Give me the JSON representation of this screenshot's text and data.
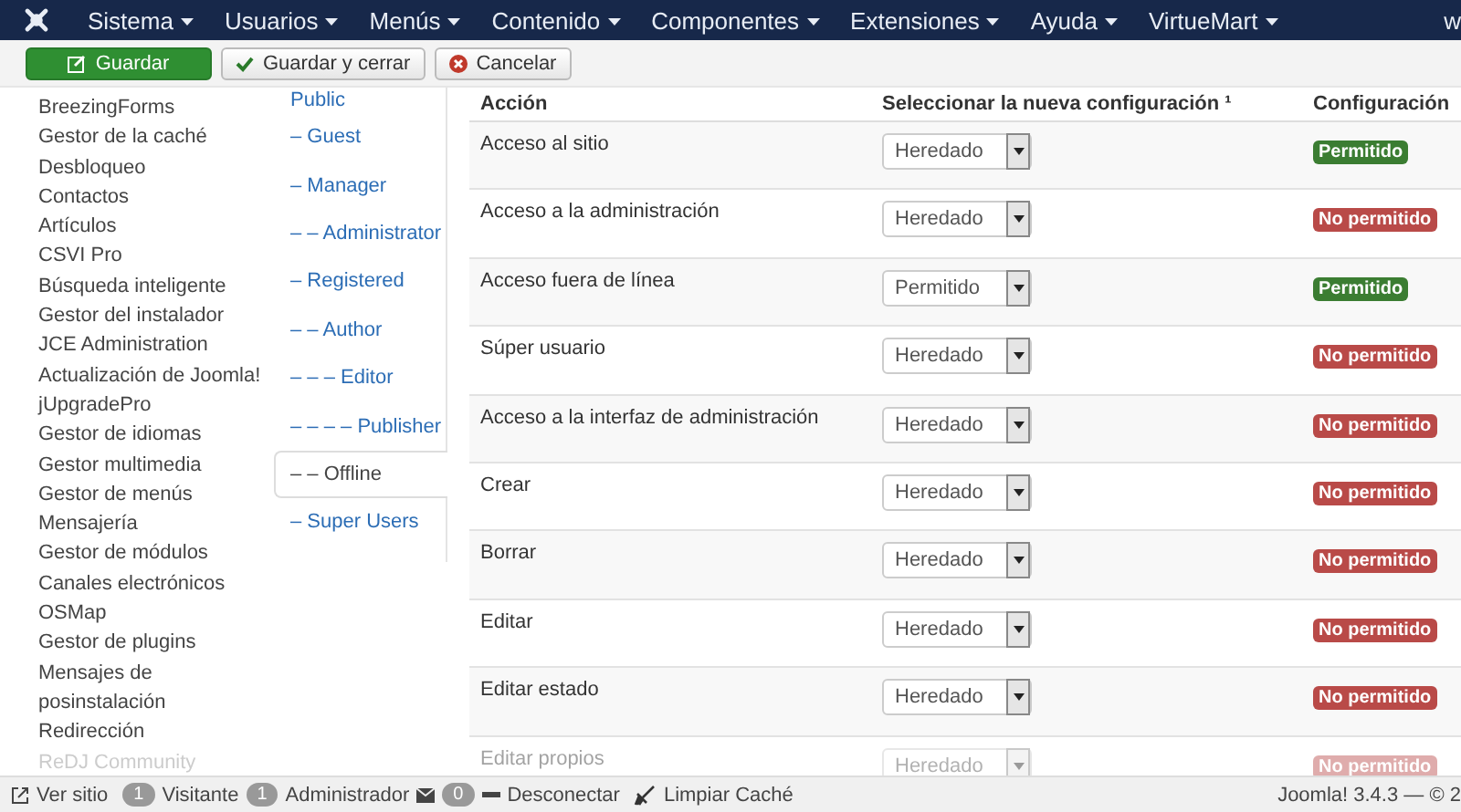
{
  "navbar": {
    "menus": [
      "Sistema",
      "Usuarios",
      "Menús",
      "Contenido",
      "Componentes",
      "Extensiones",
      "Ayuda",
      "VirtueMart"
    ],
    "right_text": "w"
  },
  "toolbar": {
    "buttons": [
      {
        "label": "Guardar",
        "kind": "primary"
      },
      {
        "label": "Guardar y cerrar",
        "kind": "check"
      },
      {
        "label": "Cancelar",
        "kind": "cancel"
      }
    ]
  },
  "sidebar": {
    "items": [
      {
        "label": "BreezingForms",
        "faded": false
      },
      {
        "label": "Gestor de la caché",
        "faded": false
      },
      {
        "label": "Desbloqueo",
        "faded": false
      },
      {
        "label": "Contactos",
        "faded": false
      },
      {
        "label": "Artículos",
        "faded": false
      },
      {
        "label": "CSVI Pro",
        "faded": false
      },
      {
        "label": "Búsqueda inteligente",
        "faded": false
      },
      {
        "label": "Gestor del instalador",
        "faded": false
      },
      {
        "label": "JCE Administration",
        "faded": false
      },
      {
        "label": "Actualización de Joomla!",
        "faded": false
      },
      {
        "label": "jUpgradePro",
        "faded": false
      },
      {
        "label": "Gestor de idiomas",
        "faded": false
      },
      {
        "label": "Gestor multimedia",
        "faded": false
      },
      {
        "label": "Gestor de menús",
        "faded": false
      },
      {
        "label": "Mensajería",
        "faded": false
      },
      {
        "label": "Gestor de módulos",
        "faded": false
      },
      {
        "label": "Canales electrónicos",
        "faded": false
      },
      {
        "label": "OSMap",
        "faded": false
      },
      {
        "label": "Gestor de plugins",
        "faded": false
      },
      {
        "label": "Mensajes de posinstalación",
        "faded": false
      },
      {
        "label": "Redirección",
        "faded": false
      },
      {
        "label": "ReDJ Community",
        "faded": true
      }
    ]
  },
  "groups": [
    {
      "label": "Public",
      "selected": false
    },
    {
      "label": "– Guest",
      "selected": false
    },
    {
      "label": "– Manager",
      "selected": false
    },
    {
      "label": "– – Administrator",
      "selected": false
    },
    {
      "label": "– Registered",
      "selected": false
    },
    {
      "label": "– – Author",
      "selected": false
    },
    {
      "label": "– – – Editor",
      "selected": false
    },
    {
      "label": "– – – – Publisher",
      "selected": false
    },
    {
      "label": "– – Offline",
      "selected": true
    },
    {
      "label": "– Super Users",
      "selected": false
    }
  ],
  "table": {
    "columns": [
      "Acción",
      "Seleccionar la nueva configuración ¹",
      "Configuración"
    ],
    "rows": [
      {
        "action": "Acceso al sitio",
        "setting": "Heredado",
        "result": "Permitido",
        "kind": "allowed",
        "faded": false
      },
      {
        "action": "Acceso a la administración",
        "setting": "Heredado",
        "result": "No permitido",
        "kind": "denied",
        "faded": false
      },
      {
        "action": "Acceso fuera de línea",
        "setting": "Permitido",
        "result": "Permitido",
        "kind": "allowed",
        "faded": false
      },
      {
        "action": "Súper usuario",
        "setting": "Heredado",
        "result": "No permitido",
        "kind": "denied",
        "faded": false
      },
      {
        "action": "Acceso a la interfaz de administración",
        "setting": "Heredado",
        "result": "No permitido",
        "kind": "denied",
        "faded": false
      },
      {
        "action": "Crear",
        "setting": "Heredado",
        "result": "No permitido",
        "kind": "denied",
        "faded": false
      },
      {
        "action": "Borrar",
        "setting": "Heredado",
        "result": "No permitido",
        "kind": "denied",
        "faded": false
      },
      {
        "action": "Editar",
        "setting": "Heredado",
        "result": "No permitido",
        "kind": "denied",
        "faded": false
      },
      {
        "action": "Editar estado",
        "setting": "Heredado",
        "result": "No permitido",
        "kind": "denied",
        "faded": false
      },
      {
        "action": "Editar propios",
        "setting": "Heredado",
        "result": "No permitido",
        "kind": "denied",
        "faded": true
      }
    ]
  },
  "status_bar": {
    "view_site": "Ver sitio",
    "visitors_count": "1",
    "visitors": "Visitante",
    "admins_count": "1",
    "admins": "Administrador",
    "messages_count": "0",
    "logout": "Desconectar",
    "clear_cache": "Limpiar Caché",
    "version": "Joomla! 3.4.3 — © 2"
  }
}
